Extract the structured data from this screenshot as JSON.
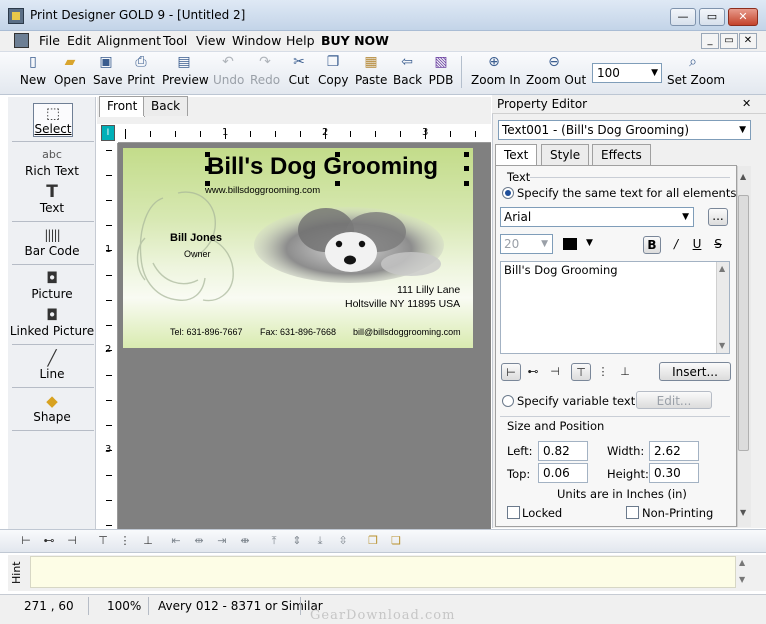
{
  "window": {
    "title": "Print Designer GOLD 9  - [Untitled 2]",
    "minimize": "—",
    "restore": "▭",
    "close": "✕"
  },
  "menu": {
    "items": [
      "File",
      "Edit",
      "Alignment",
      "Tool",
      "View",
      "Window",
      "Help",
      "BUY NOW"
    ]
  },
  "toolbar": {
    "buttons": [
      {
        "label": "New",
        "icon": "new-document-icon",
        "enabled": true
      },
      {
        "label": "Open",
        "icon": "open-folder-icon",
        "enabled": true
      },
      {
        "label": "Save",
        "icon": "save-disk-icon",
        "enabled": true
      },
      {
        "label": "Print",
        "icon": "printer-icon",
        "enabled": true
      },
      {
        "label": "Preview",
        "icon": "print-preview-icon",
        "enabled": true
      },
      {
        "label": "Undo",
        "icon": "undo-icon",
        "enabled": false
      },
      {
        "label": "Redo",
        "icon": "redo-icon",
        "enabled": false
      },
      {
        "label": "Cut",
        "icon": "scissors-icon",
        "enabled": true
      },
      {
        "label": "Copy",
        "icon": "copy-icon",
        "enabled": true
      },
      {
        "label": "Paste",
        "icon": "paste-icon",
        "enabled": true
      },
      {
        "label": "Back",
        "icon": "back-side-icon",
        "enabled": true
      },
      {
        "label": "PDB",
        "icon": "pdb-icon",
        "enabled": true
      },
      {
        "label": "Zoom In",
        "icon": "zoom-in-icon",
        "enabled": true
      },
      {
        "label": "Zoom Out",
        "icon": "zoom-out-icon",
        "enabled": true
      },
      {
        "label": "Set Zoom",
        "icon": "magnifier-icon",
        "enabled": true
      }
    ],
    "zoom_value": "100"
  },
  "toolbox": {
    "tools": [
      {
        "label": "Select",
        "icon": "select-cursor-icon"
      },
      {
        "label": "Rich Text",
        "icon": "rich-text-icon",
        "glyph": "abc"
      },
      {
        "label": "Text",
        "icon": "text-t-icon",
        "glyph": "T"
      },
      {
        "label": "Bar Code",
        "icon": "barcode-icon",
        "glyph": "|||||"
      },
      {
        "label": "Picture",
        "icon": "camera-icon",
        "glyph": "◘"
      },
      {
        "label": "Linked Picture",
        "icon": "linked-camera-icon",
        "glyph": "◘"
      },
      {
        "label": "Line",
        "icon": "line-icon",
        "glyph": "╱"
      },
      {
        "label": "Shape",
        "icon": "shape-icon",
        "glyph": "◆"
      }
    ]
  },
  "document": {
    "tabs": [
      "Front",
      "Back"
    ],
    "active_tab": "Front",
    "ruler_corner": "I",
    "hruler_labels": [
      "1",
      "2",
      "3"
    ],
    "vruler_labels": [
      "1",
      "2",
      "3"
    ]
  },
  "label": {
    "title": "Bill's Dog Grooming",
    "website": "www.billsdoggrooming.com",
    "name": "Bill Jones",
    "role": "Owner",
    "address1": "111 Lilly Lane",
    "address2": "Holtsville NY 11895 USA",
    "tel": "Tel: 631-896-7667",
    "fax": "Fax: 631-896-7668",
    "email": "bill@billsdoggrooming.com"
  },
  "property_editor": {
    "title": "Property Editor",
    "close": "✕",
    "object_select": "Text001 - (Bill's Dog Grooming)",
    "tabs": [
      "Text",
      "Style",
      "Effects"
    ],
    "active_tab": "Text",
    "text_group": "Text",
    "radio_same": "Specify the same text for all elements",
    "font": "Arial",
    "font_more": "...",
    "font_size": "20",
    "text_value": "Bill's Dog Grooming",
    "insert_button": "Insert...",
    "radio_variable": "Specify variable text",
    "edit_button": "Edit...",
    "size_group": "Size and Position",
    "left_label": "Left:",
    "left_value": "0.82",
    "width_label": "Width:",
    "width_value": "2.62",
    "top_label": "Top:",
    "top_value": "0.06",
    "height_label": "Height:",
    "height_value": "0.30",
    "units": "Units are in Inches (in)",
    "locked": "Locked",
    "non_printing": "Non-Printing",
    "format_buttons": [
      "B",
      "/",
      "U",
      "S"
    ]
  },
  "hint": {
    "label": "Hint",
    "text": ""
  },
  "status": {
    "coords": "271 , 60",
    "zoom": "100%",
    "paper": "Avery 012 - 8371 or Similar"
  },
  "watermark": "GearDownload.com",
  "colors": {
    "accent": "#00b0b8",
    "label_green": "#c3dc8a",
    "doc_background": "#808080"
  }
}
